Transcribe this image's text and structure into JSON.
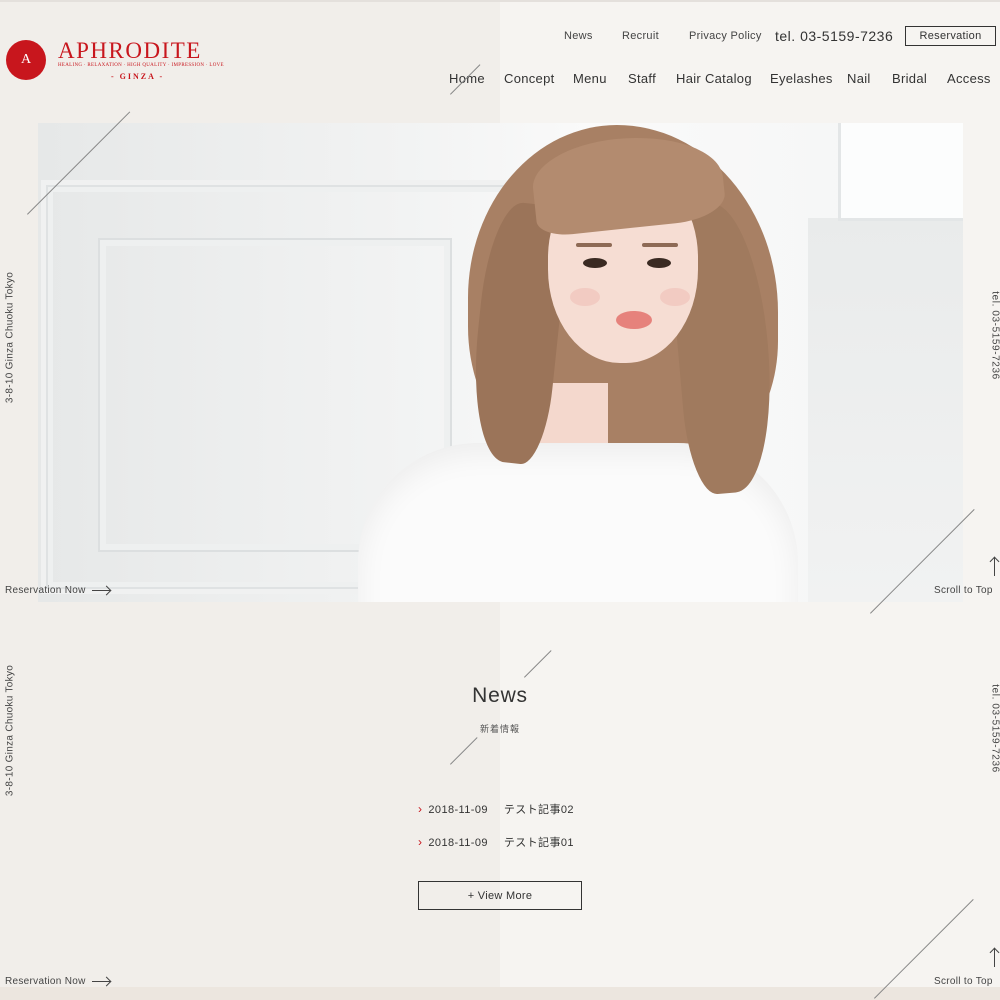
{
  "brand": {
    "initial": "A",
    "name": "APHRODITE",
    "tagline": "HEALING · RELAXATION · HIGH QUALITY · IMPRESSION · LOVE",
    "location": "- GINZA -",
    "accent_color": "#c8161d"
  },
  "utility_nav": {
    "items": [
      "News",
      "Recruit",
      "Privacy Policy"
    ],
    "tel": "tel. 03-5159-7236",
    "reservation_label": "Reservation"
  },
  "main_nav": {
    "items": [
      "Home",
      "Concept",
      "Menu",
      "Staff",
      "Hair Catalog",
      "Eyelashes",
      "Nail",
      "Bridal",
      "Access"
    ],
    "active": "Home"
  },
  "side": {
    "address": "3-8-10 Ginza Chuoku Tokyo",
    "tel": "tel. 03-5159-7236",
    "reservation_now": "Reservation Now",
    "scroll_to_top": "Scroll to Top"
  },
  "news": {
    "title": "News",
    "subtitle": "新着情報",
    "items": [
      {
        "date": "2018-11-09",
        "title": "テスト記事02"
      },
      {
        "date": "2018-11-09",
        "title": "テスト記事01"
      }
    ],
    "view_more": "+ View More"
  }
}
